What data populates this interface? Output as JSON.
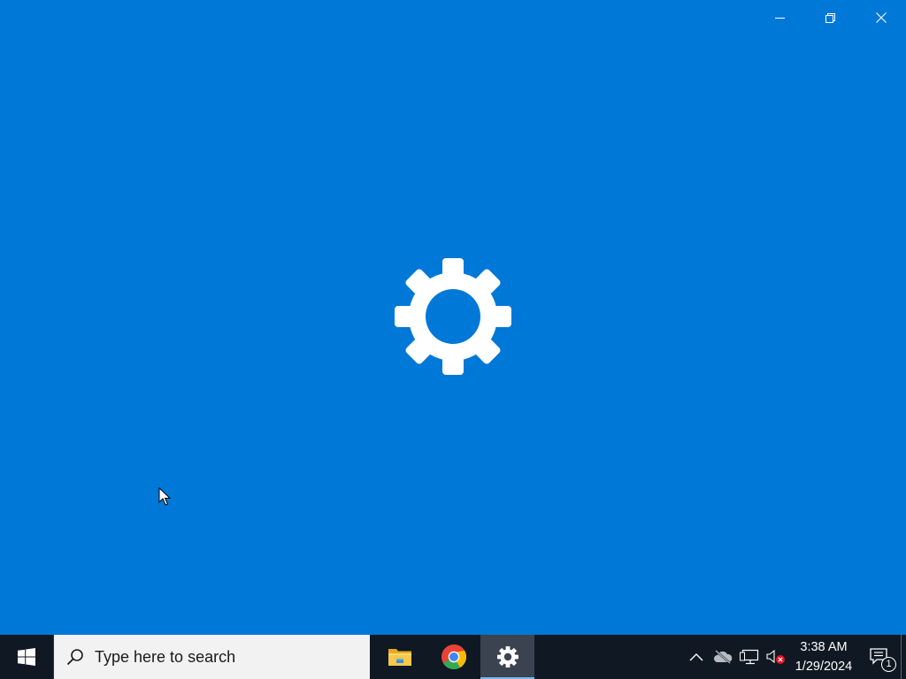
{
  "window": {
    "app": "Settings",
    "state": "launching",
    "background_color": "#0078d7",
    "splash_icon": "gear-icon",
    "caption_buttons": [
      {
        "name": "minimize",
        "icon": "minimize-icon"
      },
      {
        "name": "restore",
        "icon": "restore-icon"
      },
      {
        "name": "close",
        "icon": "close-icon"
      }
    ]
  },
  "taskbar": {
    "background_color": "#101923",
    "start_icon": "windows-logo-icon",
    "search": {
      "icon": "search-icon",
      "placeholder": "Type here to search"
    },
    "apps": [
      {
        "name": "File Explorer",
        "icon": "file-explorer-icon",
        "active": false
      },
      {
        "name": "Google Chrome",
        "icon": "chrome-icon",
        "active": false
      },
      {
        "name": "Settings",
        "icon": "settings-gear-icon",
        "active": true
      }
    ],
    "tray": {
      "icons": [
        "chevron-up-icon",
        "onedrive-offline-icon",
        "network-icon",
        "volume-muted-icon"
      ],
      "time": "3:38 AM",
      "date": "1/29/2024",
      "notifications": {
        "icon": "action-center-icon",
        "count": "1"
      }
    }
  }
}
